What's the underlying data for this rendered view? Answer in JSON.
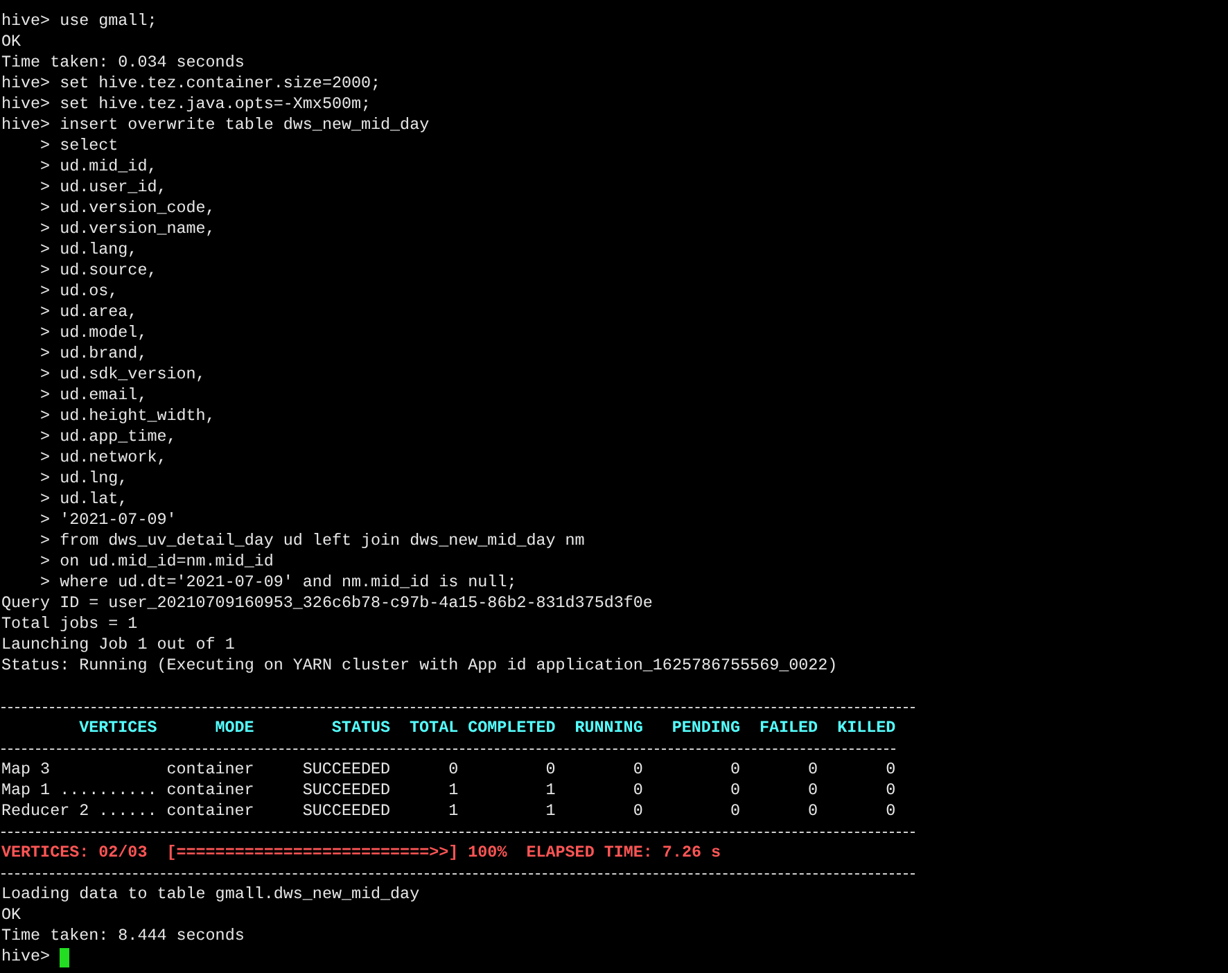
{
  "terminal": {
    "lines": [
      {
        "kind": "text",
        "text": "hive> use gmall;"
      },
      {
        "kind": "text",
        "text": "OK"
      },
      {
        "kind": "text",
        "text": "Time taken: 0.034 seconds"
      },
      {
        "kind": "text",
        "text": "hive> set hive.tez.container.size=2000;"
      },
      {
        "kind": "text",
        "text": "hive> set hive.tez.java.opts=-Xmx500m;"
      },
      {
        "kind": "text",
        "text": "hive> insert overwrite table dws_new_mid_day"
      },
      {
        "kind": "text",
        "text": "    > select"
      },
      {
        "kind": "text",
        "text": "    > ud.mid_id,"
      },
      {
        "kind": "text",
        "text": "    > ud.user_id,"
      },
      {
        "kind": "text",
        "text": "    > ud.version_code,"
      },
      {
        "kind": "text",
        "text": "    > ud.version_name,"
      },
      {
        "kind": "text",
        "text": "    > ud.lang,"
      },
      {
        "kind": "text",
        "text": "    > ud.source,"
      },
      {
        "kind": "text",
        "text": "    > ud.os,"
      },
      {
        "kind": "text",
        "text": "    > ud.area,"
      },
      {
        "kind": "text",
        "text": "    > ud.model,"
      },
      {
        "kind": "text",
        "text": "    > ud.brand,"
      },
      {
        "kind": "text",
        "text": "    > ud.sdk_version,"
      },
      {
        "kind": "text",
        "text": "    > ud.email,"
      },
      {
        "kind": "text",
        "text": "    > ud.height_width,"
      },
      {
        "kind": "text",
        "text": "    > ud.app_time,"
      },
      {
        "kind": "text",
        "text": "    > ud.network,"
      },
      {
        "kind": "text",
        "text": "    > ud.lng,"
      },
      {
        "kind": "text",
        "text": "    > ud.lat,"
      },
      {
        "kind": "text",
        "text": "    > '2021-07-09'"
      },
      {
        "kind": "text",
        "text": "    > from dws_uv_detail_day ud left join dws_new_mid_day nm"
      },
      {
        "kind": "text",
        "text": "    > on ud.mid_id=nm.mid_id"
      },
      {
        "kind": "text",
        "text": "    > where ud.dt='2021-07-09' and nm.mid_id is null;"
      },
      {
        "kind": "text",
        "text": "Query ID = user_20210709160953_326c6b78-c97b-4a15-86b2-831d375d3f0e"
      },
      {
        "kind": "text",
        "text": "Total jobs = 1"
      },
      {
        "kind": "text",
        "text": "Launching Job 1 out of 1"
      },
      {
        "kind": "text",
        "text": "Status: Running (Executing on YARN cluster with App id application_1625786755569_0022)"
      },
      {
        "kind": "blank"
      },
      {
        "kind": "rule"
      },
      {
        "kind": "table",
        "columns": [
          "VERTICES",
          "MODE",
          "STATUS",
          "TOTAL",
          "COMPLETED",
          "RUNNING",
          "PENDING",
          "FAILED",
          "KILLED"
        ],
        "rows": [
          [
            "Map 3",
            "container",
            "SUCCEEDED",
            "0",
            "0",
            "0",
            "0",
            "0",
            "0"
          ],
          [
            "Map 1 ..........",
            "container",
            "SUCCEEDED",
            "1",
            "1",
            "0",
            "0",
            "0",
            "0"
          ],
          [
            "Reducer 2 ......",
            "container",
            "SUCCEEDED",
            "1",
            "1",
            "0",
            "0",
            "0",
            "0"
          ]
        ]
      },
      {
        "kind": "rule"
      },
      {
        "kind": "progress",
        "text": "VERTICES: 02/03  [==========================>>] 100%  ELAPSED TIME: 7.26 s"
      },
      {
        "kind": "rule"
      },
      {
        "kind": "text",
        "text": "Loading data to table gmall.dws_new_mid_day"
      },
      {
        "kind": "text",
        "text": "OK"
      },
      {
        "kind": "text",
        "text": "Time taken: 8.444 seconds"
      },
      {
        "kind": "prompt",
        "text": "hive>",
        "cursor": true
      }
    ]
  }
}
